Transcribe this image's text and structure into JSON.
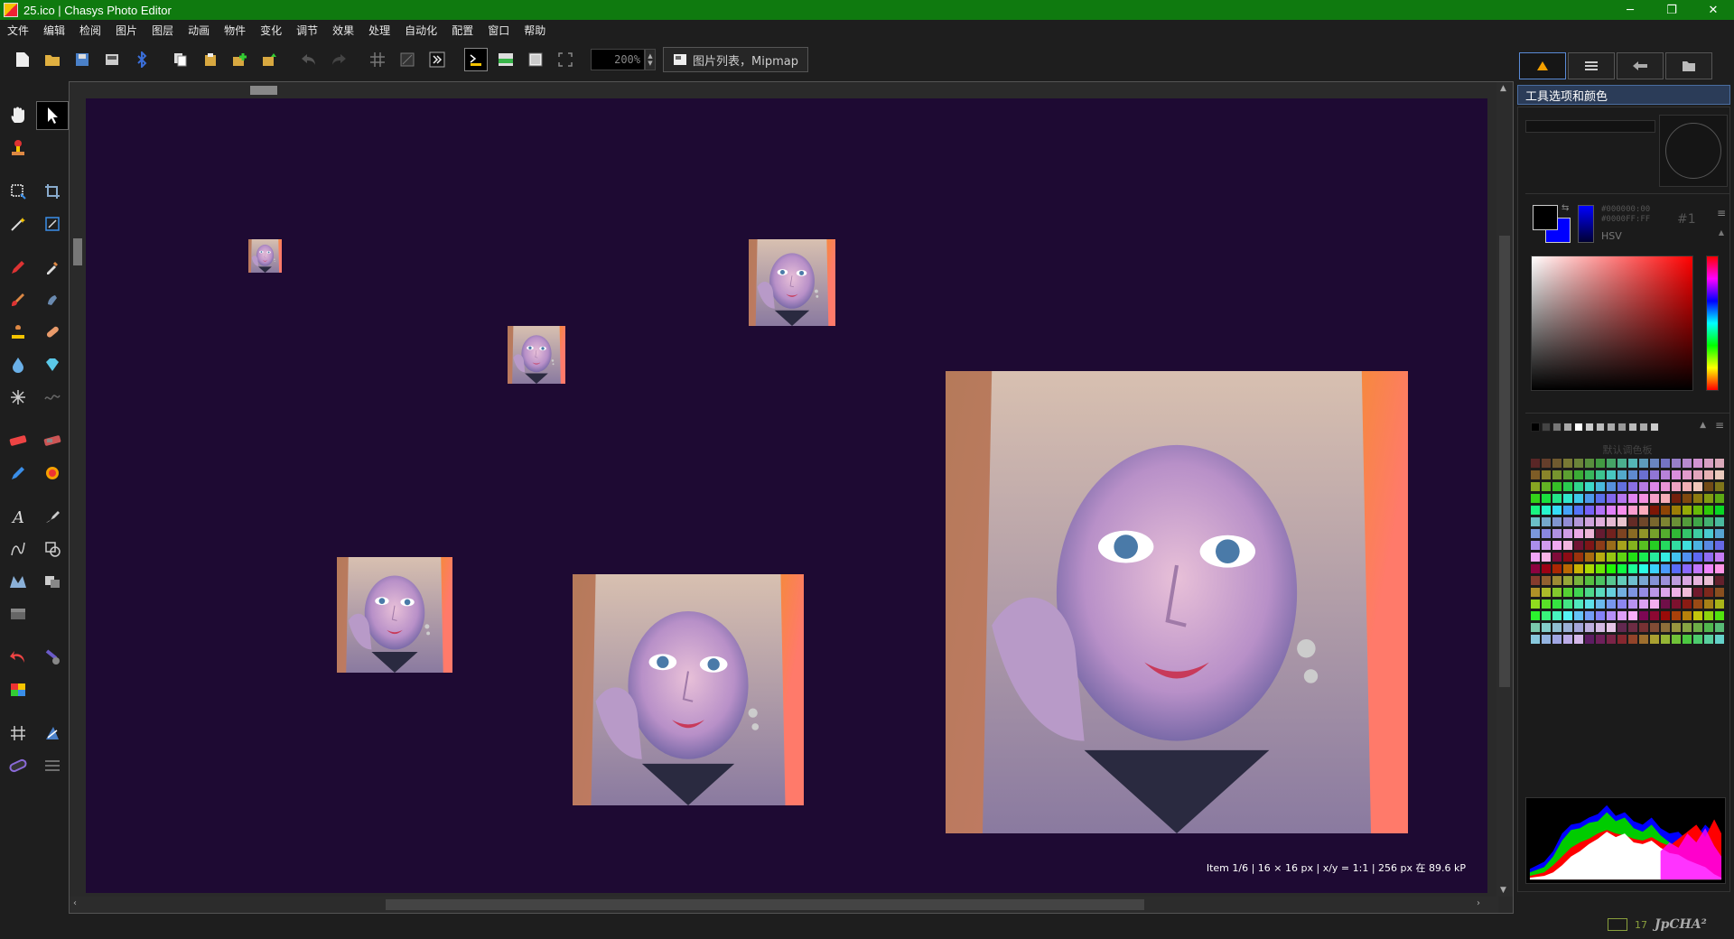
{
  "window": {
    "title": "25.ico | Chasys Photo Editor",
    "controls": {
      "minimize": "─",
      "maximize": "❐",
      "close": "✕"
    }
  },
  "menu": {
    "items": [
      "文件",
      "编辑",
      "检阅",
      "图片",
      "图层",
      "动画",
      "物件",
      "变化",
      "调节",
      "效果",
      "处理",
      "自动化",
      "配置",
      "窗口",
      "帮助"
    ]
  },
  "toolbar": {
    "zoom_value": "200%",
    "image_list_label": "图片列表，Mipmap",
    "icons": [
      "new-icon",
      "open-icon",
      "save-icon",
      "save-as-icon",
      "bluetooth-icon",
      "copy-icon",
      "paste-icon",
      "paste-new-icon",
      "import-icon",
      "undo-icon",
      "redo-icon",
      "grid-icon",
      "checker-icon",
      "script-icon",
      "terminal-icon",
      "gradient-icon",
      "square-icon",
      "fullscreen-icon"
    ]
  },
  "tools": {
    "rows": [
      [
        "hand-tool-icon",
        "pointer-tool-icon"
      ],
      [
        "stamp-tool-icon"
      ],
      [
        "rect-select-icon",
        "crop-icon"
      ],
      [
        "magic-wand-icon",
        "transform-icon"
      ],
      [
        "pencil-icon",
        "eyedropper-icon"
      ],
      [
        "brush-icon",
        "smudge-icon"
      ],
      [
        "clone-stamp-icon",
        "healing-icon"
      ],
      [
        "blur-drop-icon",
        "sharpen-icon"
      ],
      [
        "spray-icon",
        "noise-icon"
      ],
      [
        "eraser-icon",
        "bg-eraser-icon"
      ],
      [
        "color-replace-icon",
        "burn-icon"
      ],
      [
        "text-icon",
        "pen-icon"
      ],
      [
        "curve-icon",
        "shape-icon"
      ],
      [
        "warp-icon",
        "mask-icon"
      ],
      [
        "layer-block-icon"
      ],
      [
        "history-brush-icon",
        "art-history-icon"
      ],
      [
        "color-palette-icon"
      ],
      [
        "hatch-icon",
        "vector-icon"
      ],
      [
        "gradient-tool-icon",
        "settings-lines-icon"
      ]
    ]
  },
  "canvas": {
    "background": "#1e0a33",
    "status": "Item 1/6 | 16 × 16 px | x/y = 1:1 | 256 px 在 89.6 kP"
  },
  "right_panel": {
    "tabs": [
      "tool-options-tab-icon",
      "layers-tab-icon",
      "history-tab-icon",
      "folder-tab-icon"
    ],
    "header": "工具选项和颜色",
    "hex_line1": "#000000:00",
    "hex_line2": "#0000FF:FF",
    "color_mode": "HSV",
    "color_index": "#1",
    "palette_title": "默认调色板",
    "foreground_color": "#000000",
    "background_color": "#0000ff"
  },
  "status_bar": {
    "memory_value": "17",
    "logo": "JpCHA²"
  }
}
